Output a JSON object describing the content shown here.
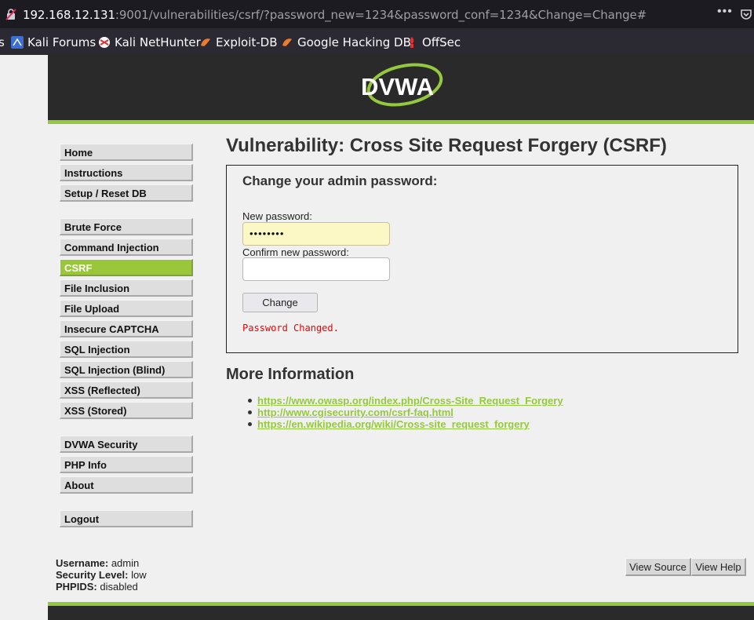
{
  "browser": {
    "url_host": "192.168.12.131",
    "url_rest": ":9001/vulnerabilities/csrf/?password_new=1234&password_conf=1234&Change=Change#",
    "menu_dots": "•••",
    "bookmarks": [
      {
        "label": "s",
        "icon": "bookmark-fragment"
      },
      {
        "label": "Kali Forums",
        "icon": "kali-forums-icon"
      },
      {
        "label": "Kali NetHunter",
        "icon": "kali-nethunter-icon"
      },
      {
        "label": "Exploit-DB",
        "icon": "exploit-db-icon"
      },
      {
        "label": "Google Hacking DB",
        "icon": "google-hacking-db-icon"
      },
      {
        "label": "OffSec",
        "icon": "offsec-icon"
      }
    ]
  },
  "logo": {
    "text": "DVWA"
  },
  "menu": {
    "items": [
      "Home",
      "Instructions",
      "Setup / Reset DB",
      "Brute Force",
      "Command Injection",
      "CSRF",
      "File Inclusion",
      "File Upload",
      "Insecure CAPTCHA",
      "SQL Injection",
      "SQL Injection (Blind)",
      "XSS (Reflected)",
      "XSS (Stored)",
      "DVWA Security",
      "PHP Info",
      "About",
      "Logout"
    ],
    "selected": "CSRF"
  },
  "main": {
    "title": "Vulnerability: Cross Site Request Forgery (CSRF)",
    "form": {
      "heading": "Change your admin password:",
      "new_label": "New password:",
      "new_value_masked": "••••••••",
      "confirm_label": "Confirm new password:",
      "confirm_value": "",
      "button": "Change",
      "status": "Password Changed."
    },
    "more_info": {
      "heading": "More Information",
      "links": [
        "https://www.owasp.org/index.php/Cross-Site_Request_Forgery",
        "http://www.cgisecurity.com/csrf-faq.html",
        "https://en.wikipedia.org/wiki/Cross-site_request_forgery"
      ]
    }
  },
  "footer": {
    "username_label": "Username:",
    "username": "admin",
    "security_label": "Security Level:",
    "security": "low",
    "phpids_label": "PHPIDS:",
    "phpids": "disabled",
    "view_source": "View Source",
    "view_help": "View Help"
  },
  "colors": {
    "accent": "#95c93d",
    "header_bg": "#2a2a2a",
    "status": "#ee0000"
  }
}
